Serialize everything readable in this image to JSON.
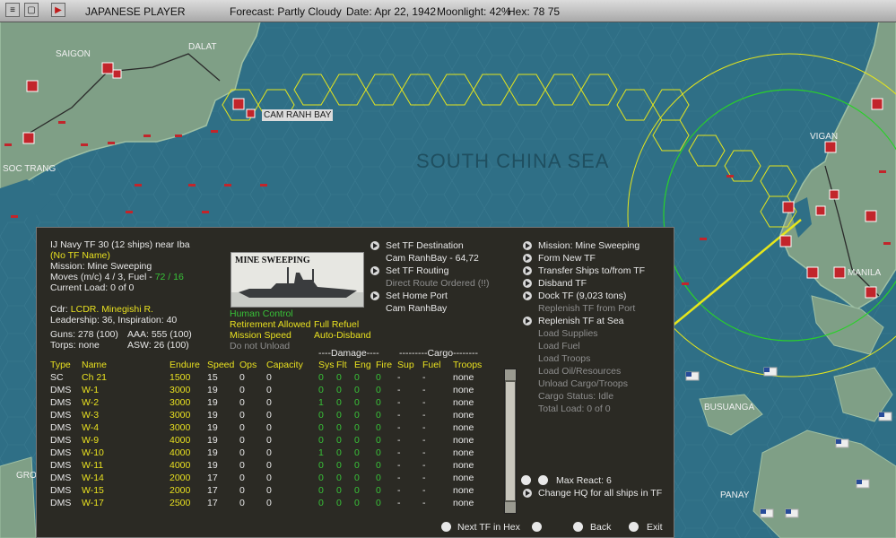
{
  "topbar": {
    "player": "JAPANESE PLAYER",
    "forecast": "Forecast: Partly Cloudy",
    "date": "Date: Apr 22, 1942",
    "moonlight": "Moonlight: 42%",
    "hex": "Hex: 78 75"
  },
  "map": {
    "labels": {
      "saigon": "SAIGON",
      "dalat": "DALAT",
      "cam_ranh_bay": "CAM RANH BAY",
      "soc_trang": "SOC TRANG",
      "south_china_sea": "SOUTH CHINA SEA",
      "vigan": "VIGAN",
      "manila": "MANILA",
      "busuanga": "BUSUANGA",
      "panay": "PANAY",
      "gro": "GRO"
    }
  },
  "panel": {
    "tf_header": "IJ Navy TF 30 (12 ships)  near Iba",
    "tf_name": "(No TF Name)",
    "mission": "Mission: Mine Sweeping",
    "moves_prefix": "Moves (m/c) 4 / 3, Fuel - ",
    "moves_fuel": "72 / 16",
    "current_load": "Current Load:  0 of 0",
    "cdr_prefix": "Cdr: ",
    "cdr_name": "LCDR. Minegishi R.",
    "leadership": "Leadership: 36, Inspiration: 40",
    "guns": "Guns: 278 (100)",
    "aaa": "AAA: 555 (100)",
    "torps": "Torps: none",
    "asw": "ASW: 26 (100)",
    "photo_caption": "MINE SWEEPING",
    "flags": {
      "human_control": "Human Control",
      "retirement": "Retirement Allowed",
      "full_refuel": "Full Refuel",
      "mission_speed": "Mission Speed",
      "auto_disband": "Auto-Disband",
      "do_not_unload": "Do not Unload"
    },
    "mid_actions": {
      "set_destination": "Set TF Destination",
      "destination_value": "Cam RanhBay - 64,72",
      "set_routing": "Set TF Routing",
      "direct_route": "Direct Route Ordered (!!)",
      "set_home_port": "Set Home Port",
      "home_port_value": "Cam RanhBay"
    },
    "right_actions": {
      "mission": "Mission: Mine Sweeping",
      "form_new": "Form New TF",
      "transfer": "Transfer Ships to/from TF",
      "disband": "Disband TF",
      "dock": "Dock TF (9,023 tons)",
      "replenish_port": "Replenish TF from Port",
      "replenish_sea": "Replenish TF at Sea",
      "load_supplies": "Load Supplies",
      "load_fuel": "Load Fuel",
      "load_troops": "Load Troops",
      "load_oil": "Load Oil/Resources",
      "unload_cargo": "Unload Cargo/Troops",
      "cargo_status": "Cargo Status: Idle",
      "total_load": "Total Load: 0 of 0"
    },
    "max_react": "Max React:  6",
    "change_hq": "Change HQ for all ships in TF",
    "next_tf": "Next TF in Hex",
    "back": "Back",
    "exit": "Exit",
    "damage_group": "----Damage----",
    "cargo_group": "---------Cargo--------",
    "columns": [
      "Type",
      "Name",
      "Endure",
      "Speed",
      "Ops",
      "Capacity",
      "Sys",
      "Flt",
      "Eng",
      "Fire",
      "Sup",
      "Fuel",
      "Troops"
    ],
    "ships": [
      [
        "SC",
        "Ch 21",
        "1500",
        "15",
        "0",
        "0",
        "0",
        "0",
        "0",
        "0",
        "-",
        "-",
        "none"
      ],
      [
        "DMS",
        "W-1",
        "3000",
        "19",
        "0",
        "0",
        "0",
        "0",
        "0",
        "0",
        "-",
        "-",
        "none"
      ],
      [
        "DMS",
        "W-2",
        "3000",
        "19",
        "0",
        "0",
        "1",
        "0",
        "0",
        "0",
        "-",
        "-",
        "none"
      ],
      [
        "DMS",
        "W-3",
        "3000",
        "19",
        "0",
        "0",
        "0",
        "0",
        "0",
        "0",
        "-",
        "-",
        "none"
      ],
      [
        "DMS",
        "W-4",
        "3000",
        "19",
        "0",
        "0",
        "0",
        "0",
        "0",
        "0",
        "-",
        "-",
        "none"
      ],
      [
        "DMS",
        "W-9",
        "4000",
        "19",
        "0",
        "0",
        "0",
        "0",
        "0",
        "0",
        "-",
        "-",
        "none"
      ],
      [
        "DMS",
        "W-10",
        "4000",
        "19",
        "0",
        "0",
        "1",
        "0",
        "0",
        "0",
        "-",
        "-",
        "none"
      ],
      [
        "DMS",
        "W-11",
        "4000",
        "19",
        "0",
        "0",
        "0",
        "0",
        "0",
        "0",
        "-",
        "-",
        "none"
      ],
      [
        "DMS",
        "W-14",
        "2000",
        "17",
        "0",
        "0",
        "0",
        "0",
        "0",
        "0",
        "-",
        "-",
        "none"
      ],
      [
        "DMS",
        "W-15",
        "2000",
        "17",
        "0",
        "0",
        "0",
        "0",
        "0",
        "0",
        "-",
        "-",
        "none"
      ],
      [
        "DMS",
        "W-17",
        "2500",
        "17",
        "0",
        "0",
        "0",
        "0",
        "0",
        "0",
        "-",
        "-",
        "none"
      ]
    ]
  }
}
